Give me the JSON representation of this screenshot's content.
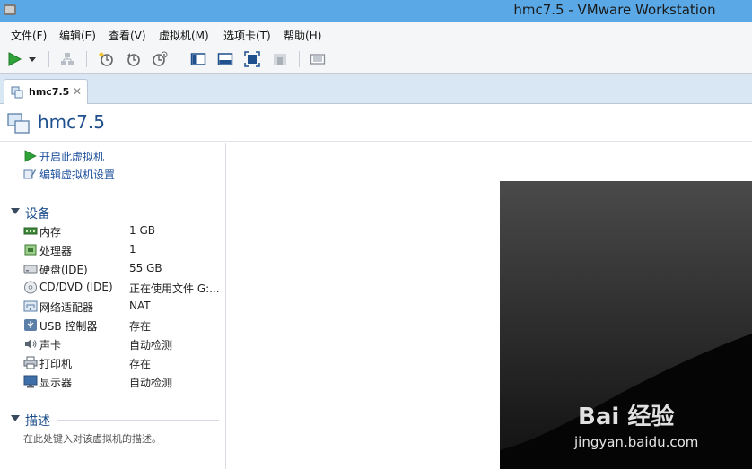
{
  "window": {
    "title": "hmc7.5 - VMware Workstation"
  },
  "menubar": {
    "items": [
      "文件(F)",
      "编辑(E)",
      "查看(V)",
      "虚拟机(M)",
      "选项卡(T)",
      "帮助(H)"
    ]
  },
  "toolbar": {
    "icons": [
      "play-icon",
      "dropdown-arrow-icon",
      "network-icon",
      "snapshot-icon",
      "revert-snapshot-icon",
      "snapshot-manager-icon",
      "sidebar-view-icon",
      "console-view-icon",
      "fullscreen-icon",
      "unity-icon",
      "thumbnail-icon"
    ]
  },
  "tab": {
    "label": "hmc7.5",
    "close": "✕"
  },
  "vm": {
    "title": "hmc7.5"
  },
  "actions": {
    "power_on": "开启此虚拟机",
    "edit_settings": "编辑虚拟机设置"
  },
  "devices": {
    "heading": "设备",
    "items": [
      {
        "name": "内存",
        "value": "1 GB",
        "icon": "memory-icon"
      },
      {
        "name": "处理器",
        "value": "1",
        "icon": "cpu-icon"
      },
      {
        "name": "硬盘(IDE)",
        "value": "55 GB",
        "icon": "harddisk-icon"
      },
      {
        "name": "CD/DVD (IDE)",
        "value": "正在使用文件 G:...",
        "icon": "cd-dvd-icon"
      },
      {
        "name": "网络适配器",
        "value": "NAT",
        "icon": "network-adapter-icon"
      },
      {
        "name": "USB 控制器",
        "value": "存在",
        "icon": "usb-icon"
      },
      {
        "name": "声卡",
        "value": "自动检测",
        "icon": "sound-icon"
      },
      {
        "name": "打印机",
        "value": "存在",
        "icon": "printer-icon"
      },
      {
        "name": "显示器",
        "value": "自动检测",
        "icon": "display-icon"
      }
    ]
  },
  "description": {
    "heading": "描述",
    "placeholder": "在此处键入对该虚拟机的描述。"
  },
  "watermark": {
    "logo": "Bai 经验",
    "url": "jingyan.baidu.com"
  },
  "colors": {
    "titlebar": "#5aa9e6",
    "accent_text": "#1f4f8c",
    "link": "#1c4f9c",
    "play_green": "#2fa33a"
  }
}
